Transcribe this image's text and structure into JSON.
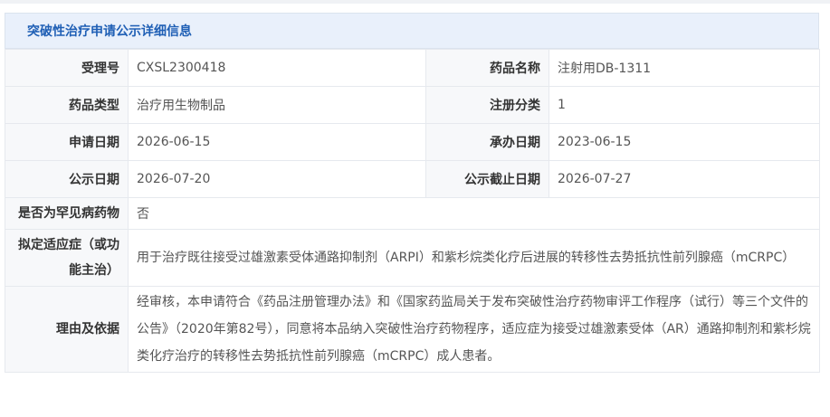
{
  "panel": {
    "title": "突破性治疗申请公示详细信息"
  },
  "rows": {
    "accept_no": {
      "label": "受理号",
      "value": "CXSL2300418"
    },
    "drug_name": {
      "label": "药品名称",
      "value": "注射用DB-1311"
    },
    "drug_type": {
      "label": "药品类型",
      "value": "治疗用生物制品"
    },
    "reg_class": {
      "label": "注册分类",
      "value": "1"
    },
    "apply_date": {
      "label": "申请日期",
      "value": "2026-06-15"
    },
    "undertake_date": {
      "label": "承办日期",
      "value": "2023-06-15"
    },
    "publish_date": {
      "label": "公示日期",
      "value": "2026-07-20"
    },
    "publish_end_date": {
      "label": "公示截止日期",
      "value": "2026-07-27"
    },
    "rare_disease": {
      "label": "是否为罕见病药物",
      "value": "否"
    },
    "indication": {
      "label": "拟定适应症（或功能主治）",
      "value": "用于治疗既往接受过雄激素受体通路抑制剂（ARPI）和紫杉烷类化疗后进展的转移性去势抵抗性前列腺癌（mCRPC）"
    },
    "reason": {
      "label": "理由及依据",
      "value": "经审核，本申请符合《药品注册管理办法》和《国家药监局关于发布突破性治疗药物审评工作程序（试行）等三个文件的公告》（2020年第82号），同意将本品纳入突破性治疗药物程序，适应症为接受过雄激素受体（AR）通路抑制剂和紫杉烷类化疗治疗的转移性去势抵抗性前列腺癌（mCRPC）成人患者。"
    }
  }
}
